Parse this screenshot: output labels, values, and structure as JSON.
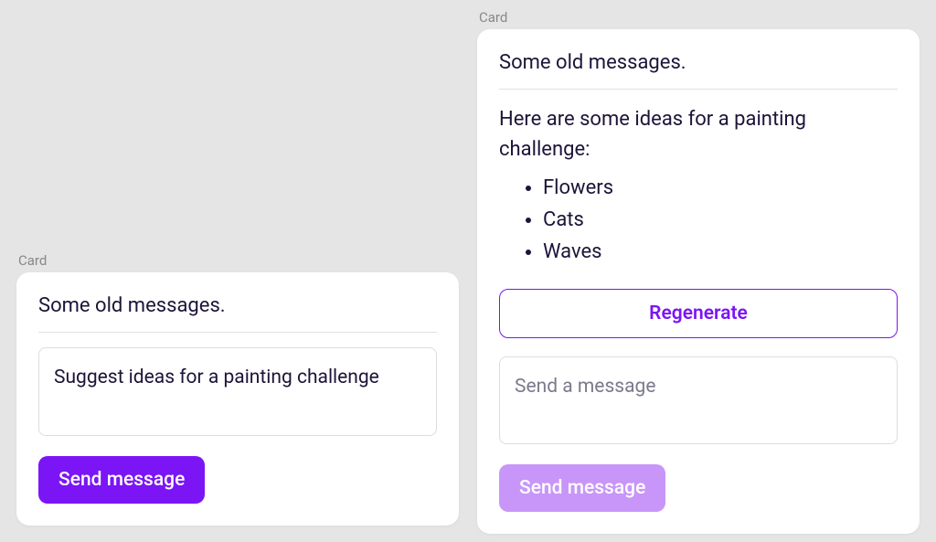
{
  "left_card": {
    "label": "Card",
    "old_messages": "Some old messages.",
    "input_value": "Suggest ideas for a painting challenge",
    "send_button": "Send message"
  },
  "right_card": {
    "label": "Card",
    "old_messages": "Some old messages.",
    "response_intro": "Here are some ideas for a painting challenge:",
    "response_items": [
      "Flowers",
      "Cats",
      "Waves"
    ],
    "regenerate_button": "Regenerate",
    "input_placeholder": "Send a message",
    "send_button": "Send message"
  }
}
